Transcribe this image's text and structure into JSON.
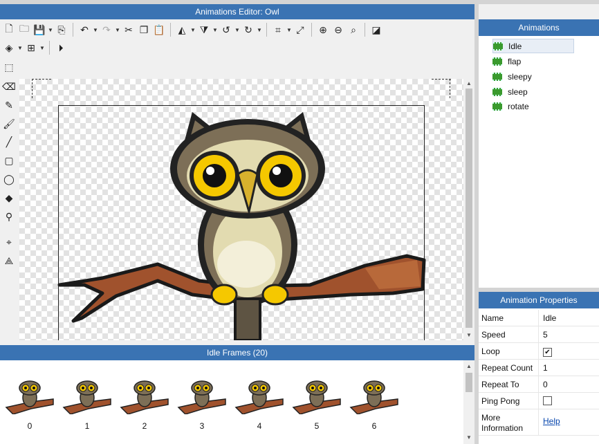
{
  "window": {
    "title": "Animations Editor: Owl"
  },
  "toolbar": {
    "row1": [
      "new-file-icon",
      "open-folder-icon",
      "save-icon",
      "export-icon",
      "undo-icon",
      "redo-icon",
      "cut-icon",
      "copy-icon",
      "paste-icon",
      "flip-horizontal-icon",
      "flip-vertical-icon",
      "rotate-left-icon",
      "rotate-right-icon",
      "crop-icon",
      "resize-icon",
      "zoom-in-icon",
      "zoom-out-icon",
      "zoom-fit-icon",
      "invert-icon"
    ],
    "row2": [
      "layers-icon",
      "grid-icon",
      "play-icon"
    ]
  },
  "tools": [
    "select-icon",
    "eraser-icon",
    "pencil-icon",
    "brush-icon",
    "line-icon",
    "rectangle-icon",
    "ellipse-icon",
    "fill-icon",
    "eyedropper-icon",
    "origin-icon",
    "bone-icon"
  ],
  "frames": {
    "header": "Idle Frames (20)",
    "items": [
      "0",
      "1",
      "2",
      "3",
      "4",
      "5",
      "6"
    ]
  },
  "animations": {
    "header": "Animations",
    "items": [
      "Idle",
      "flap",
      "sleepy",
      "sleep",
      "rotate"
    ],
    "selected": "Idle"
  },
  "properties": {
    "header": "Animation Properties",
    "rows": [
      {
        "key": "Name",
        "value": "Idle"
      },
      {
        "key": "Speed",
        "value": "5"
      },
      {
        "key": "Loop",
        "checked": true
      },
      {
        "key": "Repeat Count",
        "value": "1"
      },
      {
        "key": "Repeat To",
        "value": "0"
      },
      {
        "key": "Ping Pong",
        "checked": false
      },
      {
        "key": "More Information",
        "value": "Help"
      }
    ]
  },
  "colors": {
    "header": "#3a73b3",
    "accent_green": "#3a9a2e"
  }
}
